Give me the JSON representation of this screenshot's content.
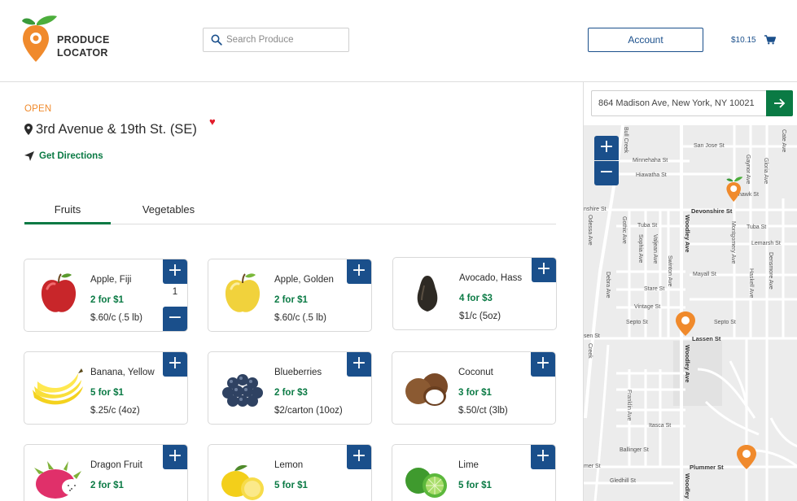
{
  "brand": {
    "line1": "PRODUCE",
    "line2": "LOCATOR",
    "colors": {
      "orange": "#f08a2c",
      "green": "#3a9a3a",
      "blue": "#1a4f8b"
    }
  },
  "header": {
    "search_placeholder": "Search Produce",
    "account_label": "Account",
    "cart_total": "$10.15"
  },
  "store": {
    "status": "OPEN",
    "name": "3rd Avenue & 19th St. (SE)",
    "directions_label": "Get Directions"
  },
  "tabs": [
    {
      "label": "Fruits",
      "active": true
    },
    {
      "label": "Vegetables",
      "active": false
    }
  ],
  "products": [
    {
      "name": "Apple, Fiji",
      "deal": "2 for $1",
      "unit": "$.60/c (.5 lb)",
      "qty": "1",
      "icon": "red-apple"
    },
    {
      "name": "Apple, Golden",
      "deal": "2 for $1",
      "unit": "$.60/c (.5 lb)",
      "icon": "golden-apple"
    },
    {
      "name": "Avocado, Hass",
      "deal": "4 for $3",
      "unit": "$1/c (5oz)",
      "icon": "avocado"
    },
    {
      "name": "Banana, Yellow",
      "deal": "5 for $1",
      "unit": "$.25/c (4oz)",
      "icon": "banana"
    },
    {
      "name": "Blueberries",
      "deal": "2 for $3",
      "unit": "$2/carton (10oz)",
      "icon": "blueberries"
    },
    {
      "name": "Coconut",
      "deal": "3 for $1",
      "unit": "$.50/ct (3lb)",
      "icon": "coconut"
    },
    {
      "name": "Dragon Fruit",
      "deal": "2 for $1",
      "unit": "",
      "icon": "dragon-fruit"
    },
    {
      "name": "Lemon",
      "deal": "5 for $1",
      "unit": "",
      "icon": "lemon"
    },
    {
      "name": "Lime",
      "deal": "5 for $1",
      "unit": "",
      "icon": "lime"
    }
  ],
  "map": {
    "address": "864 Madison Ave, New York, NY 10021",
    "zoom_in": "+",
    "zoom_out": "−",
    "streets": {
      "san_jose": "San Jose St",
      "minnehaha": "Minnehaha St",
      "hiawatha": "Hiawatha St",
      "hawk": "hawk St",
      "devonshire_left": "nshire St",
      "devonshire": "Devonshire St",
      "tuba1": "Tuba St",
      "tuba2": "Tuba St",
      "lemarsh": "Lemarsh St",
      "mayall": "Mayall St",
      "stare": "Stare St",
      "vintage": "Vintage St",
      "septo1": "Septo St",
      "septo2": "Septo St",
      "lassen": "Lassen St",
      "sen_left": "sen St",
      "ballinger": "Ballinger St",
      "itasca": "Itasca St",
      "plummer": "Plummer St",
      "plummer_left": "mer St",
      "gledhill": "Gledhill St",
      "woodley1": "Woodley Ave",
      "woodley2": "Woodley Ave",
      "woodley3": "Woodley",
      "bull_creek": "Bull Creek",
      "creek": "Creek",
      "odessa": "Odessa Ave",
      "gothic": "Gothic Ave",
      "sophia": "Sophia Ave",
      "valjean": "Valjean Ave",
      "swinton": "Swinton Ave",
      "debra": "Debra Ave",
      "montgomery": "Montgomery Ave",
      "gaynor": "Gaynor Ave",
      "gloria": "Gloria Ave",
      "densmore": "Densmore Ave",
      "haskell": "Haskell Ave",
      "frankiln": "Franklin Ave",
      "cate": "Cate Ave"
    }
  }
}
